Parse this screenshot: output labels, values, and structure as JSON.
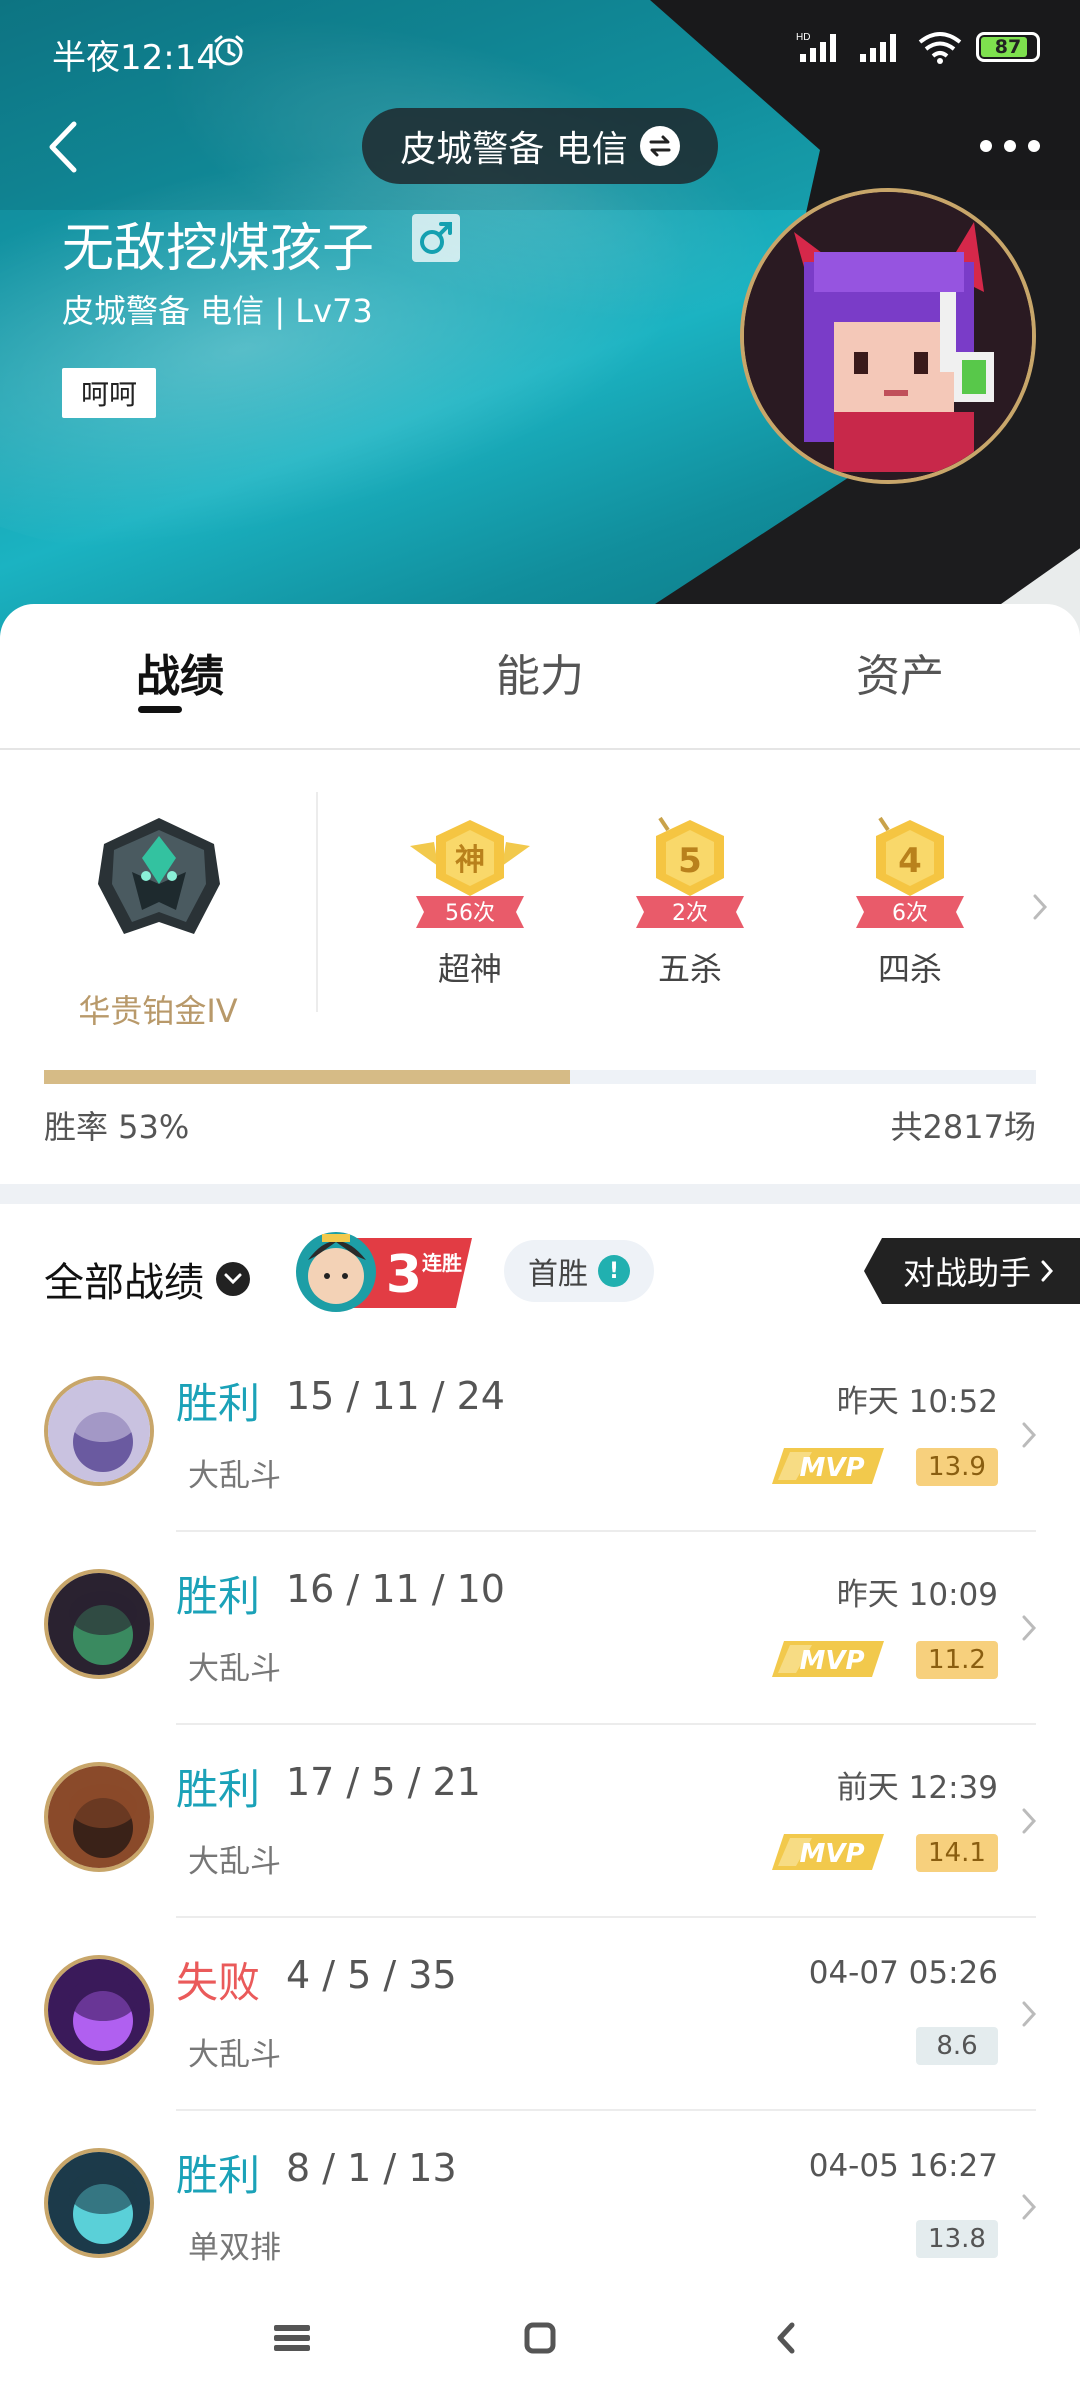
{
  "status": {
    "time": "半夜12:14",
    "battery": "87"
  },
  "header": {
    "server": "皮城警备 电信",
    "player_name": "无敌挖煤孩子",
    "player_sub": "皮城警备 电信 | Lv73",
    "tag": "呵呵"
  },
  "tabs": [
    {
      "label": "战绩",
      "active": true
    },
    {
      "label": "能力",
      "active": false
    },
    {
      "label": "资产",
      "active": false
    }
  ],
  "rank": {
    "name": "华贵铂金IV",
    "achievements": [
      {
        "glyph": "神",
        "count": "56次",
        "label": "超神"
      },
      {
        "glyph": "5",
        "count": "2次",
        "label": "五杀"
      },
      {
        "glyph": "4",
        "count": "6次",
        "label": "四杀"
      }
    ],
    "winrate_label": "胜率  53%",
    "winrate_fraction": 0.53,
    "total_games": "共2817场"
  },
  "filter": {
    "label": "全部战绩",
    "streak_number": "3",
    "streak_text": "连胜",
    "first_win": "首胜",
    "assistant": "对战助手"
  },
  "matches": [
    {
      "result": "胜利",
      "win": true,
      "kda": "15 / 11 / 24",
      "mode": "大乱斗",
      "time": "昨天 10:52",
      "mvp": true,
      "score": "13.9"
    },
    {
      "result": "胜利",
      "win": true,
      "kda": "16 / 11 / 10",
      "mode": "大乱斗",
      "time": "昨天 10:09",
      "mvp": true,
      "score": "11.2"
    },
    {
      "result": "胜利",
      "win": true,
      "kda": "17 / 5 / 21",
      "mode": "大乱斗",
      "time": "前天 12:39",
      "mvp": true,
      "score": "14.1"
    },
    {
      "result": "失败",
      "win": false,
      "kda": "4 / 5 / 35",
      "mode": "大乱斗",
      "time": "04-07 05:26",
      "mvp": false,
      "score": "8.6"
    },
    {
      "result": "胜利",
      "win": true,
      "kda": "8 / 1 / 13",
      "mode": "单双排",
      "time": "04-05 16:27",
      "mvp": false,
      "score": "13.8"
    }
  ],
  "mvp_text": "MVP",
  "colors": {
    "win": "#1ba2b8",
    "lose": "#ea5a5a",
    "gold": "#c8a66a",
    "teal": "#149cab"
  }
}
